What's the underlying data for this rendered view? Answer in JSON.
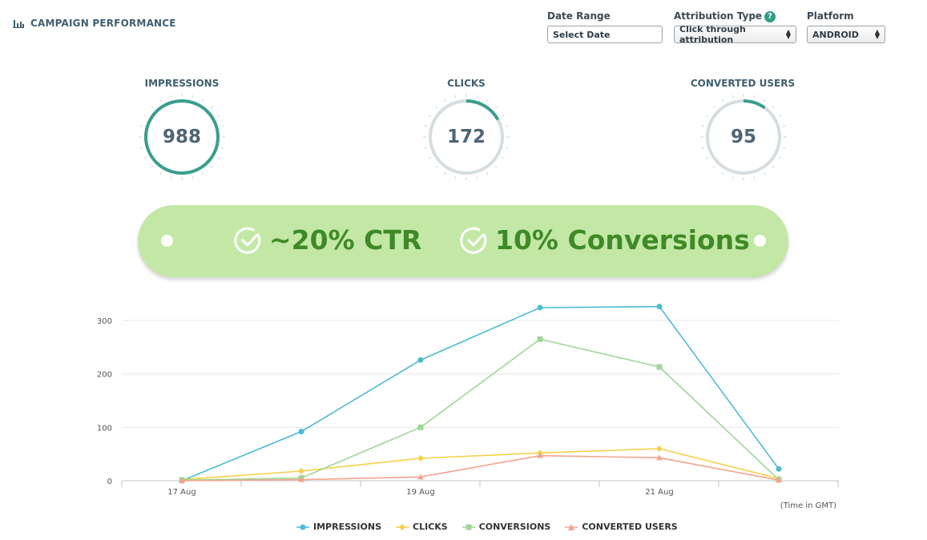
{
  "header": {
    "title": "CAMPAIGN PERFORMANCE",
    "icon": "bar-chart-icon"
  },
  "filters": {
    "date_range": {
      "label": "Date Range",
      "placeholder": "Select Date"
    },
    "attribution": {
      "label": "Attribution Type",
      "help": "?",
      "value": "Click through attribution"
    },
    "platform": {
      "label": "Platform",
      "value": "ANDROID"
    }
  },
  "metrics": [
    {
      "label": "IMPRESSIONS",
      "value": "988",
      "progress": 1.0
    },
    {
      "label": "CLICKS",
      "value": "172",
      "progress": 0.17
    },
    {
      "label": "CONVERTED USERS",
      "value": "95",
      "progress": 0.1
    }
  ],
  "banner": {
    "ctr": "~20% CTR",
    "conversions": "10% Conversions",
    "icon": "check-circle-icon"
  },
  "colors": {
    "teal": "#3a9e8e",
    "track": "#d5dde1",
    "banner_bg": "#c3e8a6",
    "banner_text": "#3f8a27",
    "impressions": "#4bbcd3",
    "clicks": "#f5d04a",
    "conversions": "#9fd69a",
    "converted_users": "#f2a48c"
  },
  "chart_data": {
    "type": "line",
    "x_tick_labels": [
      "17 Aug",
      "19 Aug",
      "21 Aug"
    ],
    "x_note": "(Time in GMT)",
    "y_ticks": [
      0,
      100,
      200,
      300
    ],
    "ylim": [
      0,
      330
    ],
    "x": [
      "17 Aug",
      "18 Aug",
      "19 Aug",
      "20 Aug",
      "21 Aug",
      "22 Aug"
    ],
    "series": [
      {
        "name": "IMPRESSIONS",
        "marker": "circle",
        "values": [
          0,
          92,
          226,
          324,
          326,
          22
        ]
      },
      {
        "name": "CLICKS",
        "marker": "diamond",
        "values": [
          2,
          18,
          42,
          52,
          60,
          4
        ]
      },
      {
        "name": "CONVERSIONS",
        "marker": "square",
        "values": [
          1,
          5,
          100,
          265,
          213,
          2
        ]
      },
      {
        "name": "CONVERTED USERS",
        "marker": "triangle",
        "values": [
          0,
          2,
          7,
          47,
          43,
          1
        ]
      }
    ],
    "grid": true,
    "legend": "bottom"
  }
}
